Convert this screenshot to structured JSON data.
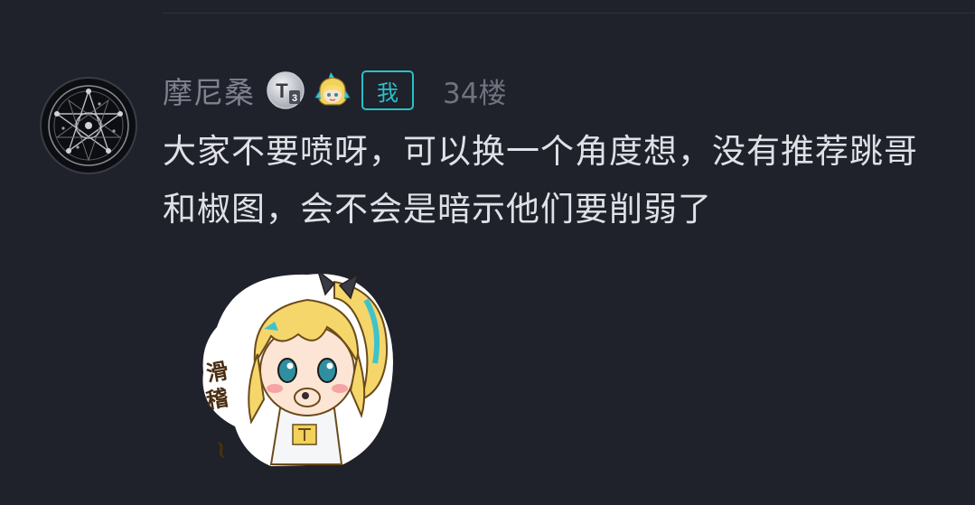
{
  "comment": {
    "username": "摩尼桑",
    "level_badge_text": "T",
    "level_badge_sub": "3",
    "me_tag": "我",
    "floor": "34楼",
    "text": "大家不要喷呀，可以换一个角度想，没有推荐跳哥和椒图，会不会是暗示他们要削弱了",
    "sticker_caption": "滑稽~"
  },
  "colors": {
    "background": "#1f212b",
    "username": "#7f838f",
    "content_text": "#dfe1e6",
    "accent_teal": "#29c1c8",
    "floor_text": "#6f737e"
  },
  "icons": {
    "avatar": "pentagram-magic-circle-avatar",
    "level_badge": "level-t3-badge-icon",
    "mascot_badge": "chibi-mascot-badge-icon",
    "sticker": "chibi-girl-sticker"
  }
}
